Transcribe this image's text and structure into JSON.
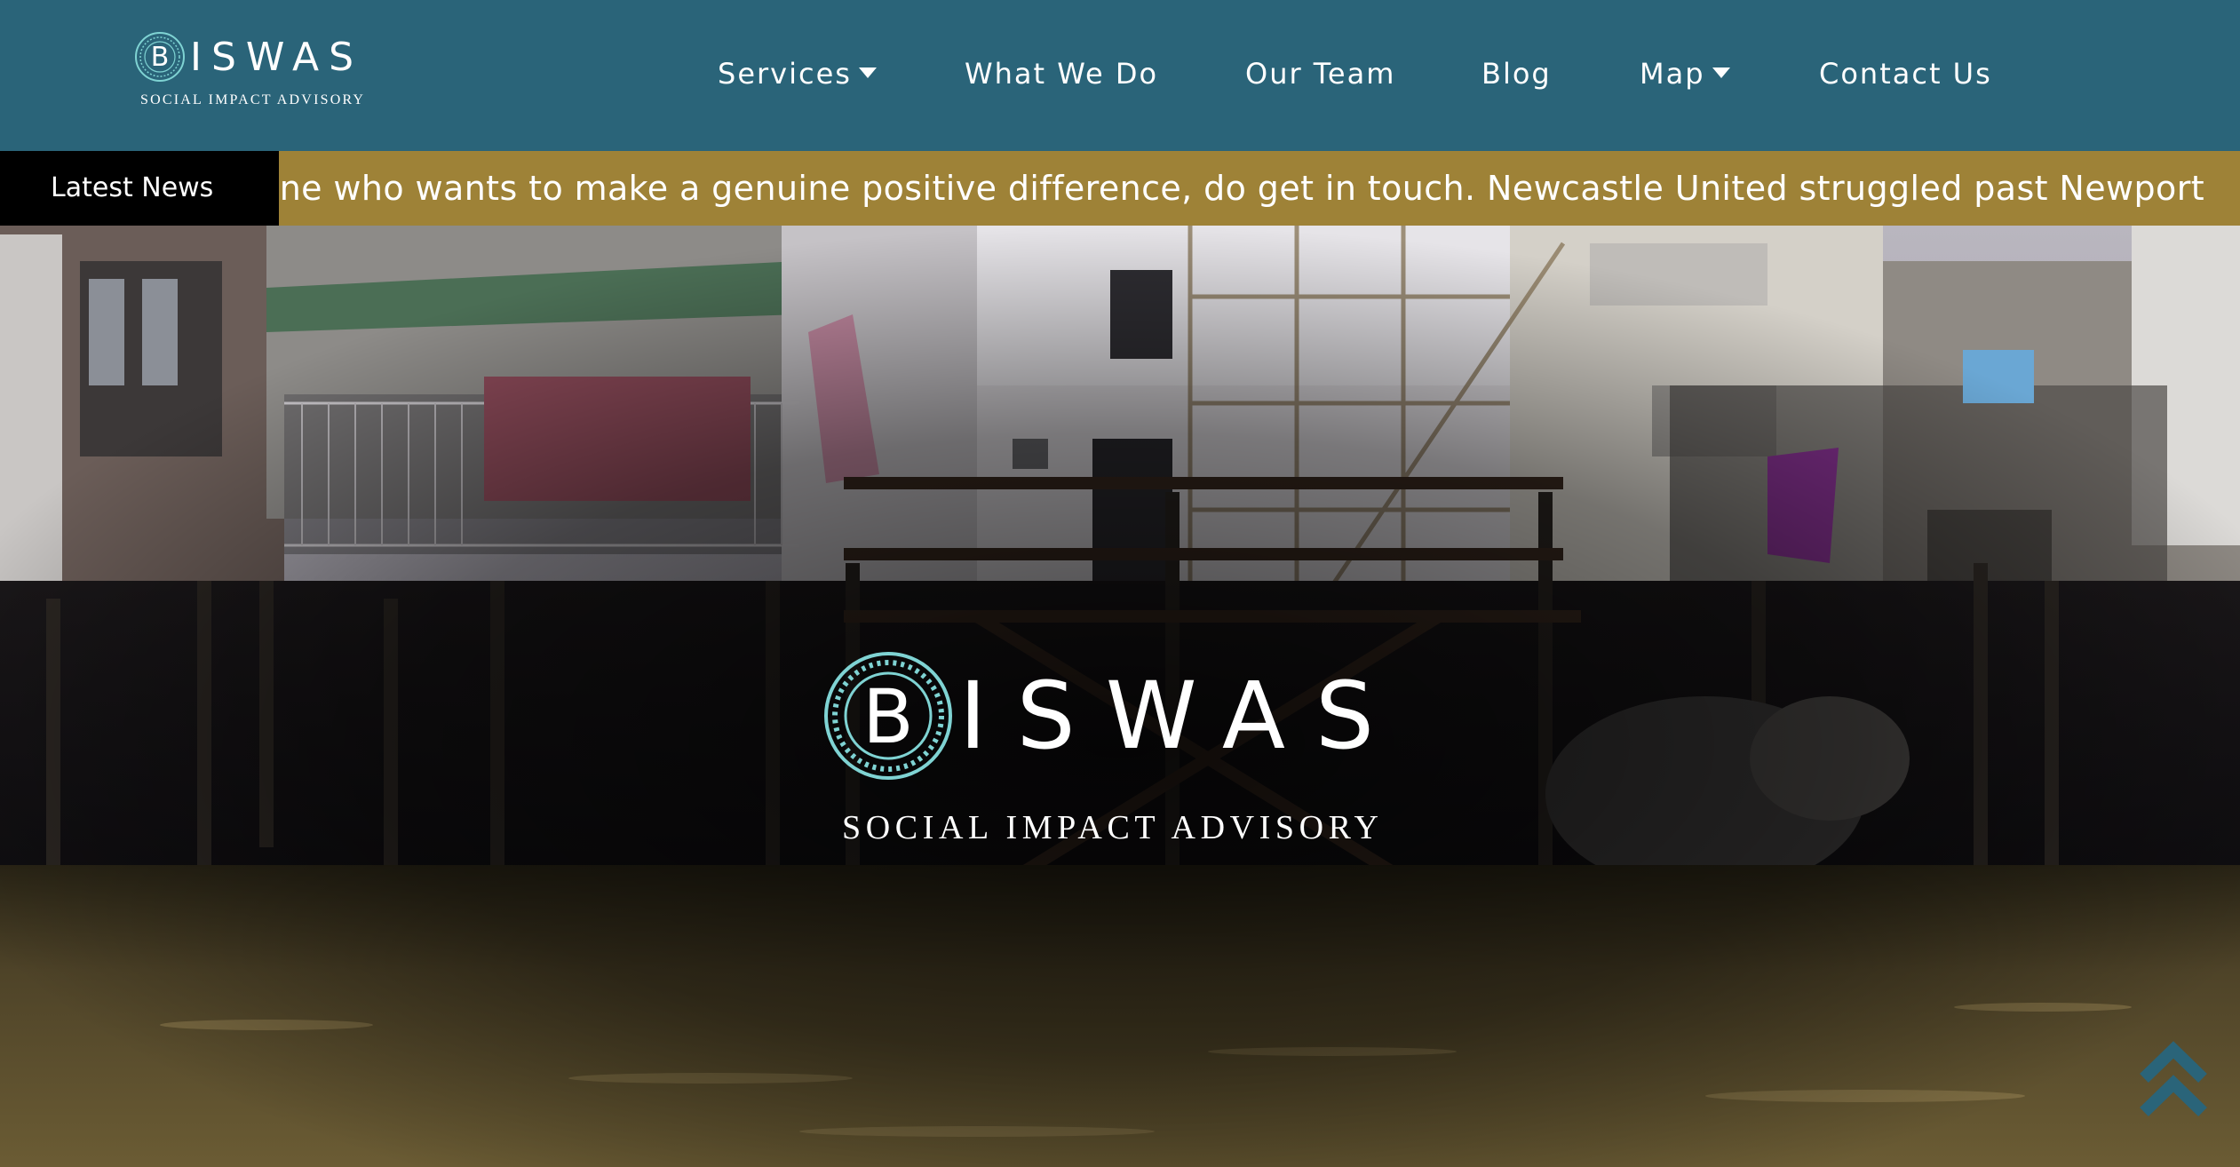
{
  "brand": {
    "name": "BISWAS",
    "initial": "B",
    "name_rest": "ISWAS",
    "tagline": "SOCIAL IMPACT ADVISORY",
    "logo_icon": "ornamental-circle-b-icon"
  },
  "nav": {
    "items": [
      {
        "label": "Services",
        "has_dropdown": true
      },
      {
        "label": "What We Do",
        "has_dropdown": false
      },
      {
        "label": "Our Team",
        "has_dropdown": false
      },
      {
        "label": "Blog",
        "has_dropdown": false
      },
      {
        "label": "Map",
        "has_dropdown": true
      },
      {
        "label": "Contact Us",
        "has_dropdown": false
      }
    ]
  },
  "ticker": {
    "label": "Latest News",
    "text": "someone who wants to make a genuine positive difference, do get in touch. Newcastle United struggled past Newport"
  },
  "hero": {
    "name_rest": "ISWAS",
    "initial": "B",
    "tagline": "SOCIAL IMPACT ADVISORY"
  },
  "back_to_top": {
    "icon": "double-chevron-up-icon"
  },
  "colors": {
    "header_bg": "#2a6479",
    "ticker_bg": "#9e8237",
    "ticker_label_bg": "#000000",
    "logo_ring": "#7fd3d3",
    "back_to_top": "#2a6479"
  }
}
